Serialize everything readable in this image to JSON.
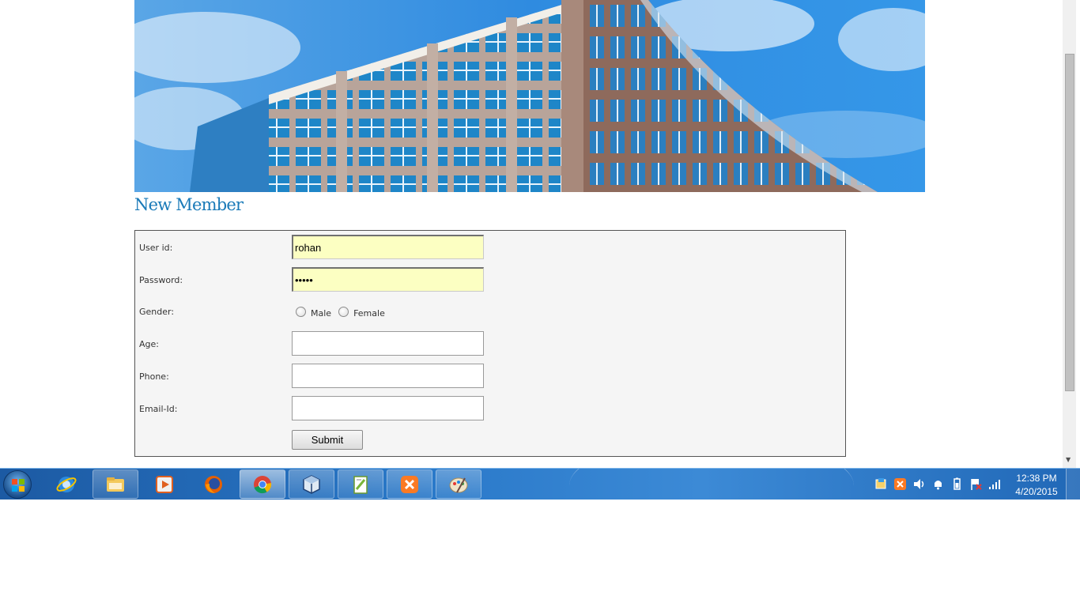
{
  "page": {
    "title": "New Member"
  },
  "form": {
    "user_id": {
      "label": "User id:",
      "value": "rohan"
    },
    "password": {
      "label": "Password:",
      "value": "•••••"
    },
    "gender": {
      "label": "Gender:",
      "options": [
        "Male",
        "Female"
      ]
    },
    "age": {
      "label": "Age:",
      "value": ""
    },
    "phone": {
      "label": "Phone:",
      "value": ""
    },
    "email": {
      "label": "Email-Id:",
      "value": ""
    },
    "submit_label": "Submit"
  },
  "taskbar": {
    "apps": [
      "internet-explorer-icon",
      "file-explorer-icon",
      "media-player-icon",
      "firefox-icon",
      "chrome-icon",
      "virtualbox-icon",
      "notepad-plus-plus-icon",
      "xampp-icon",
      "paint-icon"
    ],
    "clock": {
      "time": "12:38 PM",
      "date": "4/20/2015"
    }
  },
  "colors": {
    "title": "#1a7ab8",
    "highlight_field": "#fcffc2",
    "taskbar": "#2a79c9"
  }
}
